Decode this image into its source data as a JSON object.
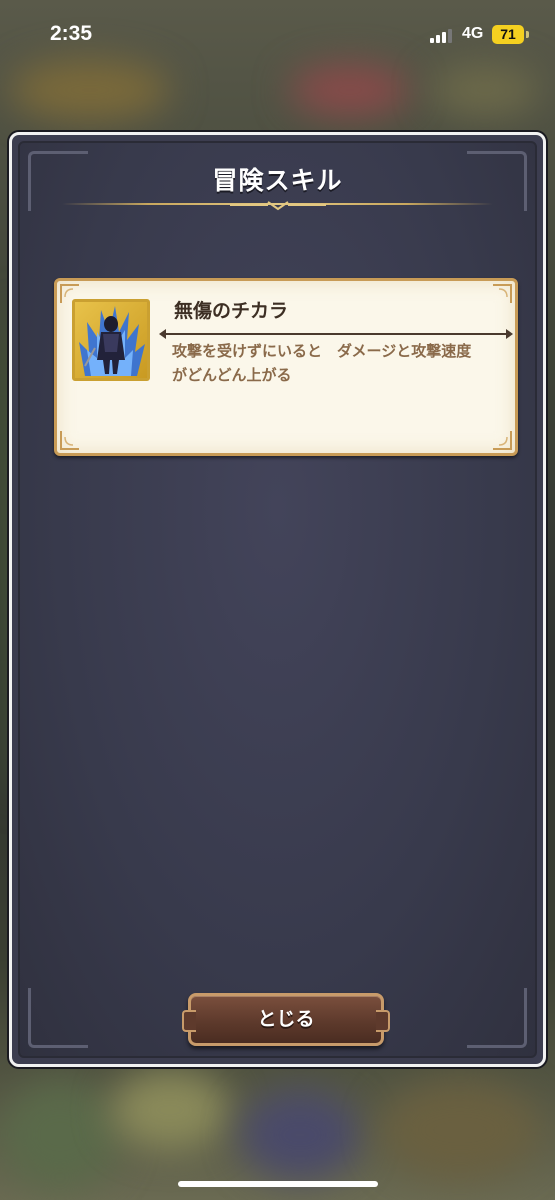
{
  "status_bar": {
    "time": "2:35",
    "network": "4G",
    "battery": "71",
    "battery_color": "#f5d020"
  },
  "dialog": {
    "title": "冒険スキル",
    "skill": {
      "name": "無傷のチカラ",
      "description": "攻撃を受けずにいると　ダメージと攻撃速度\nがどんどん上がる",
      "thumbnail_icon": "character-portrait-icon"
    },
    "close_label": "とじる"
  },
  "colors": {
    "dialog_bg": "#3c3d4f",
    "card_bg": "#fbf7ea",
    "card_border": "#c89b56",
    "button_bg": "#5e3a2c",
    "accent_gold": "#c9a85e"
  }
}
